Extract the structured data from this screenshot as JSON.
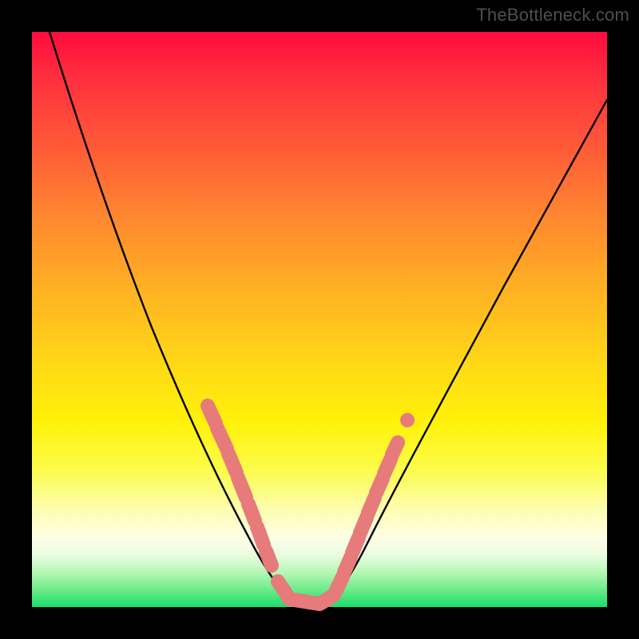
{
  "watermark": "TheBottleneck.com",
  "colors": {
    "curve": "#000000",
    "marker": "#e77a7b",
    "gradient_top": "#ff0b3e",
    "gradient_bottom": "#18df6c",
    "frame": "#000000"
  },
  "chart_data": {
    "type": "line",
    "title": "",
    "xlabel": "",
    "ylabel": "",
    "xlim": [
      0,
      100
    ],
    "ylim": [
      0,
      100
    ],
    "grid": false,
    "legend": false,
    "series": [
      {
        "name": "bottleneck-curve",
        "x": [
          3,
          6,
          10,
          14,
          18,
          22,
          26,
          30,
          33,
          36,
          38,
          40,
          42,
          44,
          46,
          48,
          50,
          53,
          56,
          60,
          65,
          70,
          76,
          82,
          88,
          94,
          100
        ],
        "y": [
          100,
          92,
          82,
          72,
          62,
          53,
          44,
          36,
          29,
          23,
          18,
          13,
          9,
          5,
          2,
          0,
          0,
          2,
          7,
          13,
          21,
          30,
          40,
          50,
          60,
          69,
          78
        ]
      }
    ],
    "annotations": {
      "highlighted_segments_left": [
        [
          31,
          36
        ],
        [
          32,
          33
        ],
        [
          33,
          30
        ],
        [
          34,
          28
        ],
        [
          35,
          25
        ],
        [
          36,
          22
        ],
        [
          36.5,
          20
        ],
        [
          37.5,
          16
        ],
        [
          38.5,
          12
        ],
        [
          40,
          8
        ]
      ],
      "highlighted_segments_right": [
        [
          51,
          2
        ],
        [
          52,
          4
        ],
        [
          53,
          7
        ],
        [
          54,
          10
        ],
        [
          55,
          13
        ],
        [
          56,
          16
        ],
        [
          57,
          19
        ],
        [
          58,
          22
        ],
        [
          59,
          25
        ],
        [
          60,
          28
        ],
        [
          61,
          30
        ],
        [
          63,
          34
        ],
        [
          65,
          38
        ]
      ],
      "flat_bottom_range_x": [
        43,
        50
      ],
      "isolated_dot_right": [
        64,
        36
      ]
    },
    "background_gradient_note": "red (high bottleneck) at top to green (no bottleneck) at bottom"
  }
}
